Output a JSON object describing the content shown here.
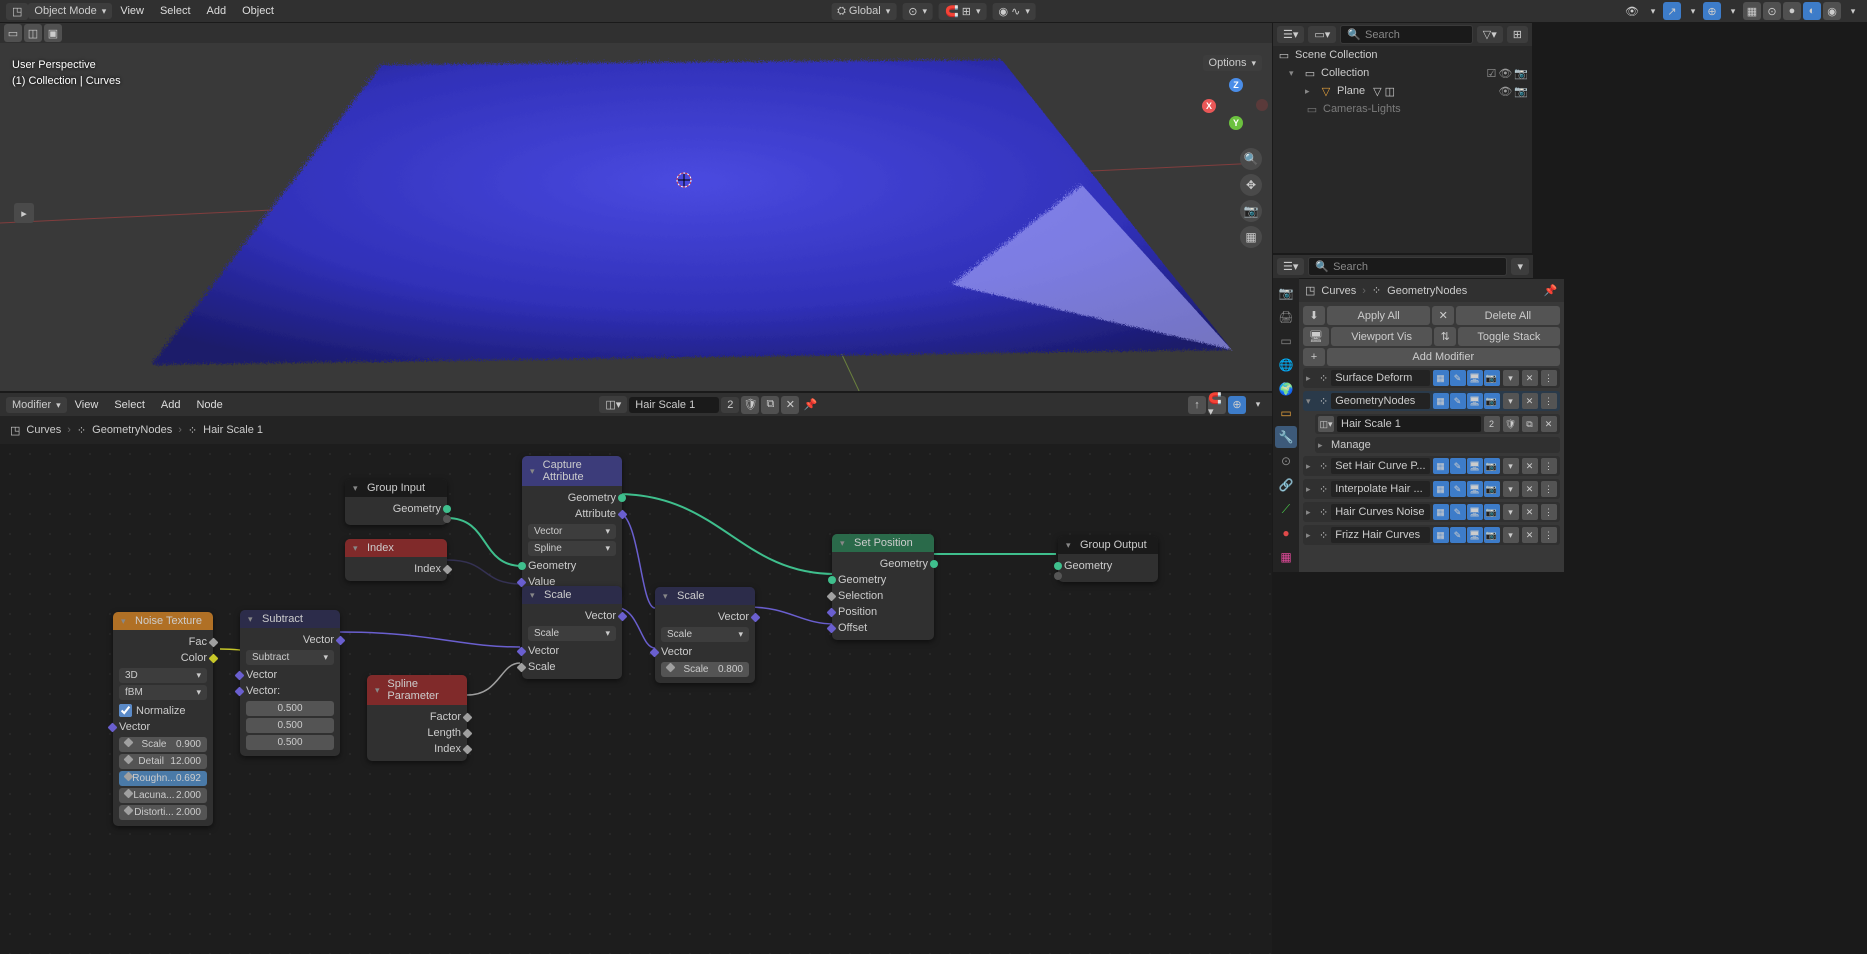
{
  "viewport": {
    "header": {
      "mode": "Object Mode",
      "menus": [
        "View",
        "Select",
        "Add",
        "Object"
      ],
      "orientation": "Global",
      "options_label": "Options"
    },
    "overlay": {
      "line1": "User Perspective",
      "line2": "(1) Collection | Curves"
    },
    "gizmo": {
      "x": "X",
      "y": "Y",
      "z": "Z"
    }
  },
  "node_editor": {
    "header": {
      "type": "Modifier",
      "menus": [
        "View",
        "Select",
        "Add",
        "Node"
      ],
      "group_name": "Hair Scale 1",
      "users": "2"
    },
    "breadcrumb": [
      "Curves",
      "GeometryNodes",
      "Hair Scale 1"
    ],
    "nodes": {
      "noise": {
        "title": "Noise Texture",
        "out_fac": "Fac",
        "out_color": "Color",
        "dim": "3D",
        "type": "fBM",
        "normalize": "Normalize",
        "in_vector": "Vector",
        "p_scale_l": "Scale",
        "p_scale_v": "0.900",
        "p_detail_l": "Detail",
        "p_detail_v": "12.000",
        "p_rough_l": "Roughn...",
        "p_rough_v": "0.692",
        "p_lacun_l": "Lacuna...",
        "p_lacun_v": "2.000",
        "p_distort_l": "Distorti...",
        "p_distort_v": "2.000"
      },
      "subtract": {
        "title": "Subtract",
        "out_vector": "Vector",
        "op": "Subtract",
        "in_vector": "Vector",
        "in_vector2": "Vector:",
        "vx": "0.500",
        "vy": "0.500",
        "vz": "0.500"
      },
      "group_input": {
        "title": "Group Input",
        "out_geometry": "Geometry"
      },
      "index": {
        "title": "Index",
        "out_index": "Index"
      },
      "capture": {
        "title": "Capture Attribute",
        "out_geometry": "Geometry",
        "out_attribute": "Attribute",
        "dtype": "Vector",
        "domain": "Spline",
        "in_geometry": "Geometry",
        "in_value": "Value"
      },
      "scale1": {
        "title": "Scale",
        "out_vector": "Vector",
        "op": "Scale",
        "in_vector": "Vector",
        "in_scale": "Scale"
      },
      "scale2": {
        "title": "Scale",
        "out_vector": "Vector",
        "op": "Scale",
        "in_vector": "Vector",
        "in_scale_l": "Scale",
        "in_scale_v": "0.800"
      },
      "spline": {
        "title": "Spline Parameter",
        "out_factor": "Factor",
        "out_length": "Length",
        "out_index": "Index"
      },
      "setpos": {
        "title": "Set Position",
        "out_geometry": "Geometry",
        "in_geometry": "Geometry",
        "in_selection": "Selection",
        "in_position": "Position",
        "in_offset": "Offset"
      },
      "group_output": {
        "title": "Group Output",
        "in_geometry": "Geometry"
      }
    }
  },
  "outliner": {
    "search_placeholder": "Search",
    "scene": "Scene Collection",
    "collection": "Collection",
    "items": [
      {
        "name": "Plane",
        "icons": [
          "▽",
          "◫"
        ]
      },
      {
        "name": "Cameras-Lights"
      }
    ]
  },
  "properties": {
    "search_placeholder": "Search",
    "bc_obj": "Curves",
    "bc_mod": "GeometryNodes",
    "apply_all": "Apply All",
    "delete_all": "Delete All",
    "viewport_vis": "Viewport Vis",
    "toggle_stack": "Toggle Stack",
    "add_modifier": "Add Modifier",
    "manage": "Manage",
    "node_group": "Hair Scale 1",
    "node_users": "2",
    "modifiers": [
      {
        "name": "Surface Deform"
      },
      {
        "name": "GeometryNodes"
      },
      {
        "name": "Set Hair Curve P..."
      },
      {
        "name": "Interpolate Hair ..."
      },
      {
        "name": "Hair Curves Noise"
      },
      {
        "name": "Frizz Hair Curves"
      }
    ]
  }
}
